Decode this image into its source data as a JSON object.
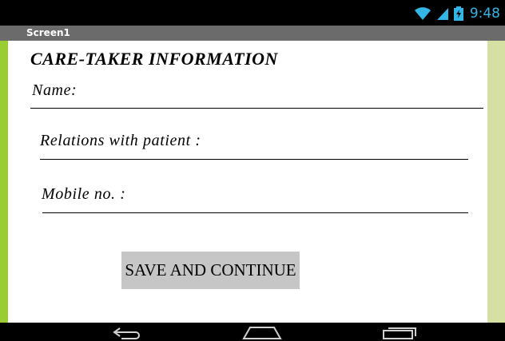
{
  "status_bar": {
    "time": "9:48",
    "icons": [
      "wifi-icon",
      "signal-icon",
      "battery-charging-icon"
    ],
    "icon_color": "#33b5e5"
  },
  "app": {
    "screen_title": "Screen1"
  },
  "form": {
    "heading": "CARE-TAKER INFORMATION",
    "fields": [
      {
        "label": "Name:"
      },
      {
        "label": "Relations with patient :"
      },
      {
        "label": "Mobile no. :"
      }
    ],
    "submit_label": "SAVE AND CONTINUE"
  },
  "nav_bar": {
    "icons": [
      "back-icon",
      "home-icon",
      "recent-apps-icon"
    ]
  },
  "colors": {
    "accent_left": "#9acd32",
    "accent_right": "#d6e0a3",
    "title_bar": "#6b6b6b",
    "button": "#c6c6c6"
  }
}
